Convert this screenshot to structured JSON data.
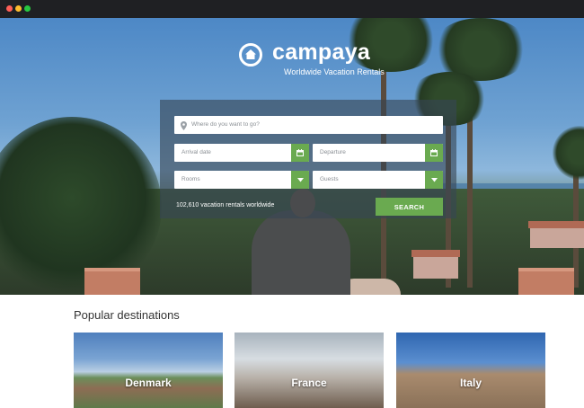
{
  "window": {
    "controls": [
      "close",
      "minimize",
      "maximize"
    ]
  },
  "brand": {
    "name": "campaya",
    "tagline": "Worldwide Vacation Rentals",
    "logo_icon": "house-icon"
  },
  "search": {
    "where_placeholder": "Where do you want to go?",
    "arrival_placeholder": "Arrival date",
    "departure_placeholder": "Departure",
    "rooms_placeholder": "Rooms",
    "guests_placeholder": "Guests",
    "count_text": "102,610 vacation rentals worldwide",
    "button_label": "SEARCH"
  },
  "popular": {
    "title": "Popular destinations",
    "destinations": [
      {
        "name": "Denmark"
      },
      {
        "name": "France"
      },
      {
        "name": "Italy"
      }
    ]
  },
  "colors": {
    "accent": "#6aaa50",
    "titlebar": "#1f2023",
    "panel": "#374654"
  }
}
